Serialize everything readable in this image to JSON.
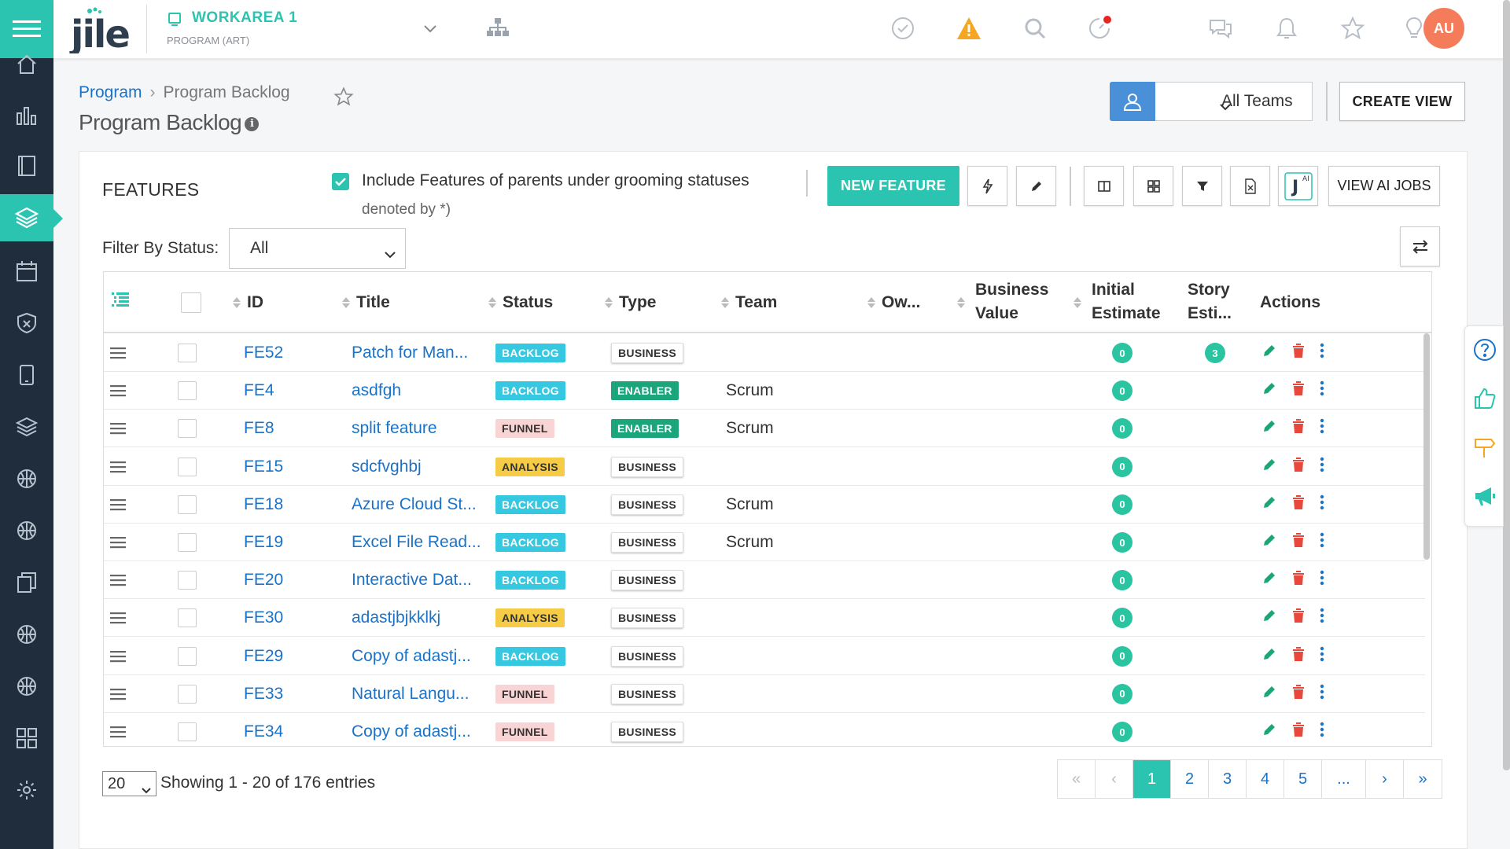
{
  "header": {
    "workarea_name": "WORKAREA 1",
    "workarea_sub": "PROGRAM (ART)",
    "avatar": "AU",
    "icons": [
      "check-circle-icon",
      "warning-icon",
      "search-icon",
      "timer-icon",
      "chat-icon",
      "bell-icon",
      "star-icon",
      "lightbulb-icon"
    ]
  },
  "sidebar": {
    "items": [
      "home-icon",
      "chart-icon",
      "book-icon",
      "layers-icon",
      "calendar-icon",
      "shield-icon",
      "tablet-icon",
      "stack-icon",
      "ball-icon",
      "ball-icon",
      "documents-icon",
      "ball-icon",
      "ball-icon",
      "apps-grid-icon",
      "gear-icon"
    ]
  },
  "breadcrumb": {
    "root": "Program",
    "current": "Program Backlog"
  },
  "page_title": "Program Backlog",
  "teams": {
    "selected": "All Teams"
  },
  "create_view_label": "CREATE VIEW",
  "features": {
    "title": "FEATURES",
    "include_label": "Include Features of parents under grooming statuses",
    "denoted_label": "denoted by *)",
    "new_feature_label": "NEW FEATURE",
    "view_ai_jobs_label": "VIEW AI JOBS",
    "filter_label": "Filter By Status:",
    "filter_value": "All"
  },
  "table": {
    "headers": {
      "id": "ID",
      "title": "Title",
      "status": "Status",
      "type": "Type",
      "team": "Team",
      "owner": "Ow...",
      "business_value_1": "Business",
      "business_value_2": "Value",
      "initial_estimate_1": "Initial",
      "initial_estimate_2": "Estimate",
      "story_estimate_1": "Story",
      "story_estimate_2": "Esti...",
      "actions": "Actions"
    },
    "rows": [
      {
        "id": "FE52",
        "title": "Patch for Man...",
        "status": "BACKLOG",
        "type": "BUSINESS",
        "team": "",
        "initial": "0",
        "story": "3"
      },
      {
        "id": "FE4",
        "title": "asdfgh",
        "status": "BACKLOG",
        "type": "ENABLER",
        "team": "Scrum",
        "initial": "0",
        "story": ""
      },
      {
        "id": "FE8",
        "title": "split feature",
        "status": "FUNNEL",
        "type": "ENABLER",
        "team": "Scrum",
        "initial": "0",
        "story": ""
      },
      {
        "id": "FE15",
        "title": "sdcfvghbj",
        "status": "ANALYSIS",
        "type": "BUSINESS",
        "team": "",
        "initial": "0",
        "story": ""
      },
      {
        "id": "FE18",
        "title": "Azure Cloud St...",
        "status": "BACKLOG",
        "type": "BUSINESS",
        "team": "Scrum",
        "initial": "0",
        "story": ""
      },
      {
        "id": "FE19",
        "title": "Excel File Read...",
        "status": "BACKLOG",
        "type": "BUSINESS",
        "team": "Scrum",
        "initial": "0",
        "story": ""
      },
      {
        "id": "FE20",
        "title": "Interactive Dat...",
        "status": "BACKLOG",
        "type": "BUSINESS",
        "team": "",
        "initial": "0",
        "story": ""
      },
      {
        "id": "FE30",
        "title": "adastjbjkklkj",
        "status": "ANALYSIS",
        "type": "BUSINESS",
        "team": "",
        "initial": "0",
        "story": ""
      },
      {
        "id": "FE29",
        "title": "Copy of adastj...",
        "status": "BACKLOG",
        "type": "BUSINESS",
        "team": "",
        "initial": "0",
        "story": ""
      },
      {
        "id": "FE33",
        "title": "Natural Langu...",
        "status": "FUNNEL",
        "type": "BUSINESS",
        "team": "",
        "initial": "0",
        "story": ""
      },
      {
        "id": "FE34",
        "title": "Copy of adastj...",
        "status": "FUNNEL",
        "type": "BUSINESS",
        "team": "",
        "initial": "0",
        "story": ""
      }
    ]
  },
  "footer": {
    "page_size": "20",
    "showing": "Showing 1 - 20 of 176 entries",
    "pages": [
      "«",
      "‹",
      "1",
      "2",
      "3",
      "4",
      "5",
      "...",
      "›",
      "»"
    ],
    "active_page": "1"
  },
  "colors": {
    "accent": "#2bc4b0",
    "sidebar": "#1f2d3d",
    "link": "#1a73c8"
  }
}
